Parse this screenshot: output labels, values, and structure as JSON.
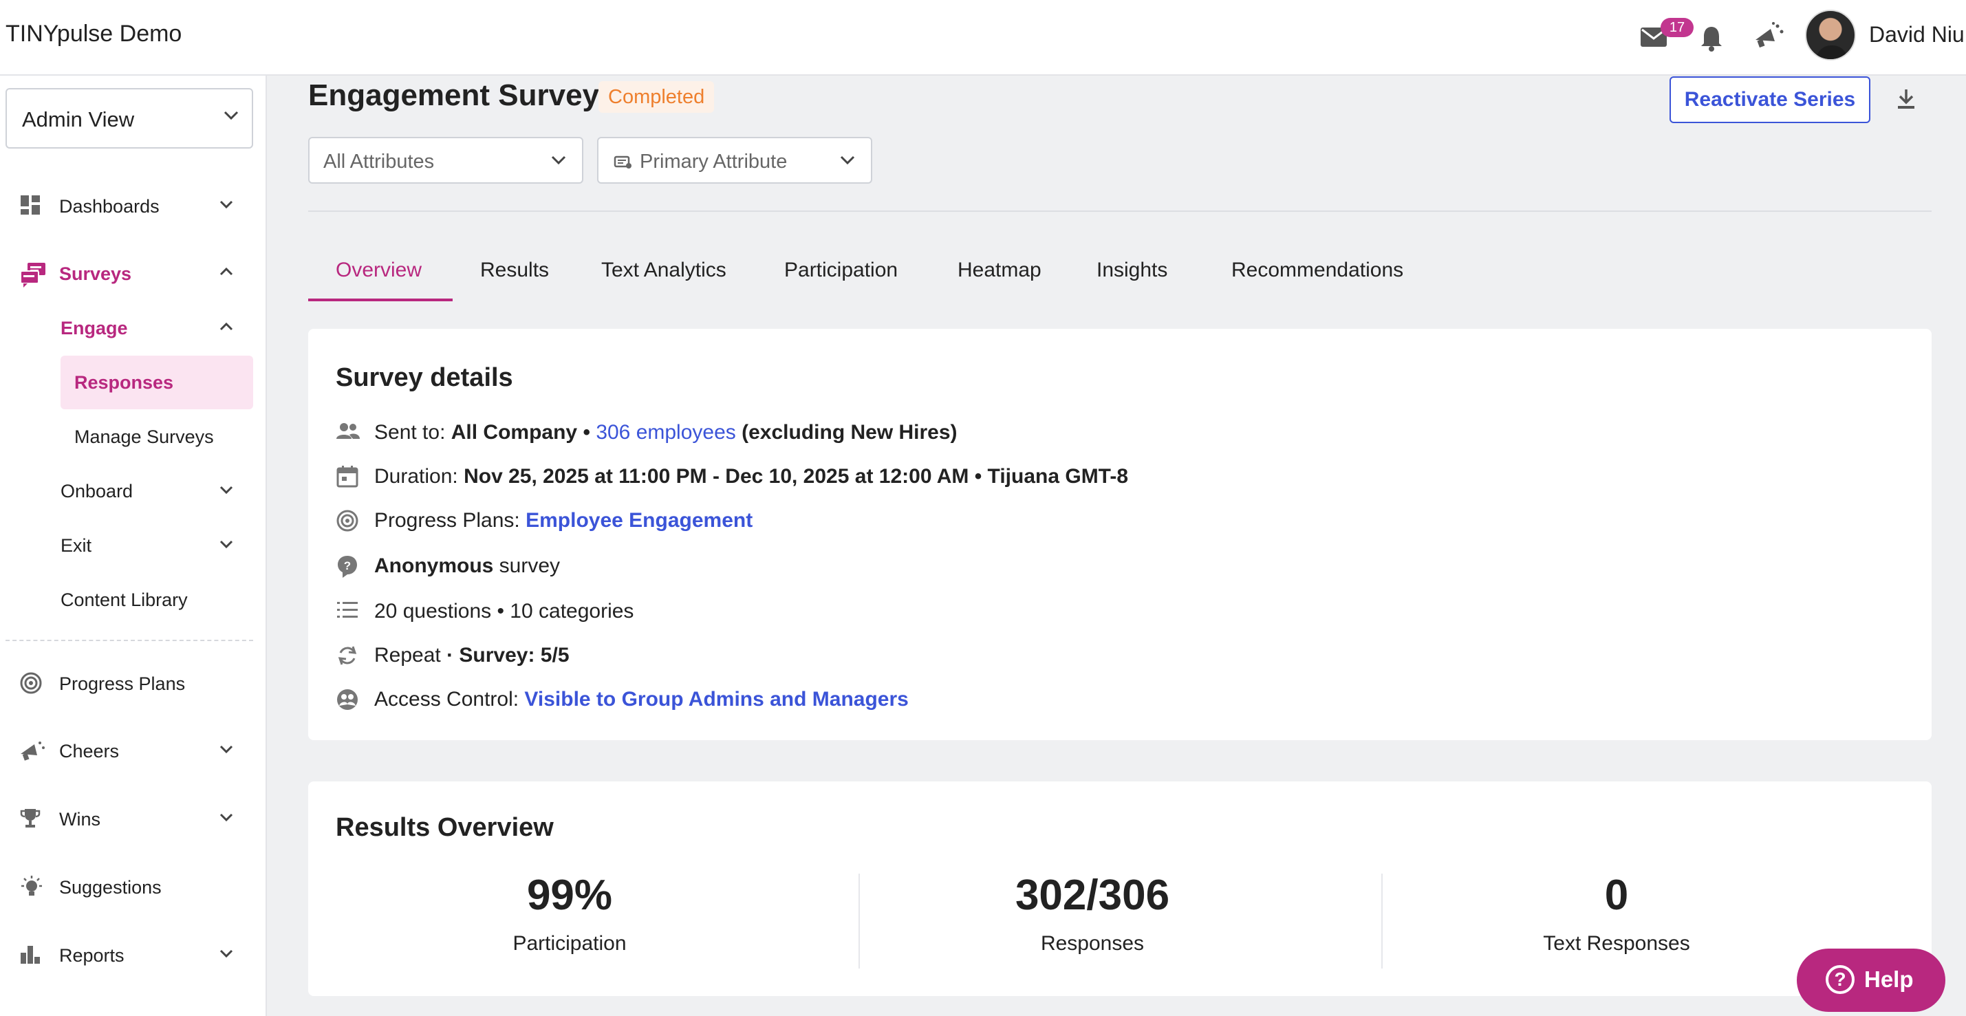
{
  "app": {
    "title": "TINYpulse Demo"
  },
  "header": {
    "mail_badge": "17",
    "user_name": "David Niu"
  },
  "sidebar": {
    "view_select": "Admin View",
    "items": [
      {
        "label": "Dashboards"
      },
      {
        "label": "Surveys"
      },
      {
        "label": "Progress Plans"
      },
      {
        "label": "Cheers"
      },
      {
        "label": "Wins"
      },
      {
        "label": "Suggestions"
      },
      {
        "label": "Reports"
      }
    ],
    "surveys_sub": [
      {
        "label": "Engage"
      },
      {
        "label": "Responses"
      },
      {
        "label": "Manage Surveys"
      },
      {
        "label": "Onboard"
      },
      {
        "label": "Exit"
      },
      {
        "label": "Content Library"
      }
    ]
  },
  "page": {
    "title": "Engagement Survey",
    "status": "Completed",
    "reactivate_label": "Reactivate Series",
    "filters": {
      "attributes": "All Attributes",
      "primary": "Primary Attribute"
    },
    "tabs": [
      "Overview",
      "Results",
      "Text Analytics",
      "Participation",
      "Heatmap",
      "Insights",
      "Recommendations"
    ]
  },
  "details": {
    "title": "Survey details",
    "sent_to_label": "Sent to:",
    "sent_to_group": "All Company",
    "sep": "•",
    "employees_link": "306 employees",
    "excluding": "(excluding New Hires)",
    "duration_label": "Duration:",
    "duration_value": "Nov 25, 2025 at 11:00 PM - Dec 10, 2025 at 12:00 AM • Tijuana GMT-8",
    "progress_label": "Progress Plans:",
    "progress_link": "Employee Engagement",
    "anonymous_bold": "Anonymous",
    "anonymous_rest": " survey",
    "questions": "20 questions • 10 categories",
    "repeat_label": "Repeat",
    "repeat_bold": " · Survey: 5/5",
    "access_label": "Access Control:",
    "access_link": "Visible to Group Admins and Managers"
  },
  "results": {
    "title": "Results Overview",
    "stats": [
      {
        "value": "99%",
        "label": "Participation"
      },
      {
        "value": "302/306",
        "label": "Responses"
      },
      {
        "value": "0",
        "label": "Text Responses"
      }
    ]
  },
  "help": {
    "label": "Help"
  },
  "colors": {
    "accent": "#b8287f",
    "link": "#3b54d8",
    "status": "#ee7f2d"
  }
}
